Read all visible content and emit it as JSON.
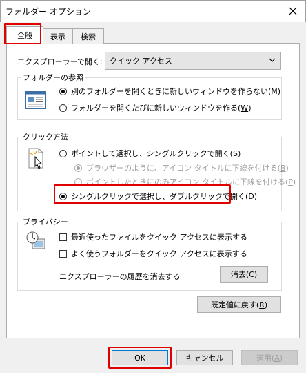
{
  "window": {
    "title": "フォルダー オプション"
  },
  "tabs": [
    {
      "label": "全般"
    },
    {
      "label": "表示"
    },
    {
      "label": "検索"
    }
  ],
  "explorer_open": {
    "label": "エクスプローラーで開く:",
    "value": "クイック アクセス"
  },
  "folder_browse": {
    "title": "フォルダーの参照",
    "opt_same": "別のフォルダーを開くときに新しいウィンドウを作らない(",
    "opt_same_key": "M",
    "opt_new": "フォルダーを開くたびに新しいウィンドウを作る(",
    "opt_new_key": "W"
  },
  "click_method": {
    "title": "クリック方法",
    "opt_single": "ポイントして選択し、シングルクリックで開く(",
    "opt_single_key": "S",
    "sub_browser": "ブラウザーのように、アイコン タイトルに下線を付ける(",
    "sub_browser_key": "B",
    "sub_point": "ポイントしたときにのみアイコン タイトルに下線を付ける(",
    "sub_point_key": "P",
    "opt_double": "シングルクリックで選択し、ダブルクリックで開く(",
    "opt_double_key": "D"
  },
  "privacy": {
    "title": "プライバシー",
    "recent_files": "最近使ったファイルをクイック アクセスに表示する",
    "freq_folders": "よく使うフォルダーをクイック アクセスに表示する",
    "clear_label": "エクスプローラーの履歴を消去する",
    "clear_button": "消去(",
    "clear_key": "C"
  },
  "restore_defaults": {
    "label": "既定値に戻す(",
    "key": "R"
  },
  "footer": {
    "ok": "OK",
    "cancel": "キャンセル",
    "apply": "適用(",
    "apply_key": "A"
  },
  "symbols": {
    "close_paren": ")"
  },
  "colors": {
    "highlight": "#e00000",
    "focus": "#0078d7"
  }
}
